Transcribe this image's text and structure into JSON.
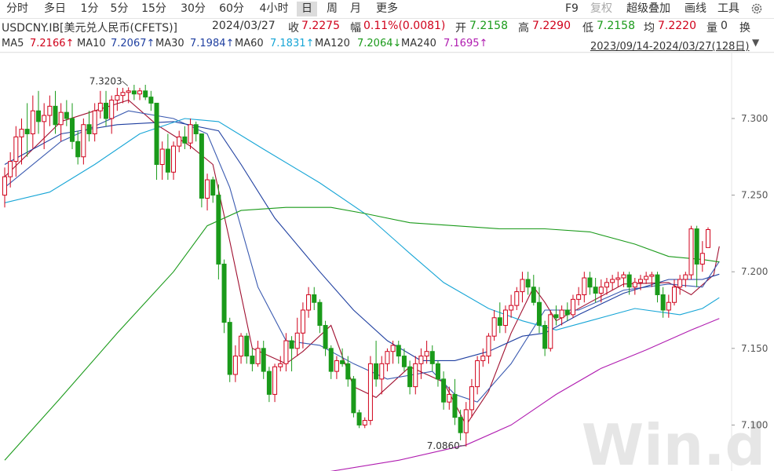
{
  "toolbar": {
    "periods": [
      "分时",
      "多日",
      "1分",
      "5分",
      "15分",
      "30分",
      "60分",
      "4小时",
      "日",
      "周",
      "月",
      "更多"
    ],
    "active_period": "日",
    "right": {
      "f9": "F9",
      "fuquan": "复权",
      "overlay": "超级叠加",
      "draw": "画线",
      "tools": "工具"
    },
    "settings_icon": "gear-icon"
  },
  "info": {
    "symbol": "USDCNY.IB[美元兑人民币(CFETS)]",
    "date": "2024/03/27",
    "close_label": "收",
    "close": "7.2275",
    "change_label": "幅",
    "change": "0.11%(0.0081)",
    "open_label": "开",
    "open": "7.2158",
    "high_label": "高",
    "high": "7.2290",
    "low_label": "低",
    "low": "7.2158",
    "avg_label": "均",
    "avg": "7.2220",
    "vol_label": "量",
    "vol": "0",
    "turnover_label": "换"
  },
  "ma_bar": {
    "items": [
      {
        "label": "MA5",
        "value": "7.2166↑",
        "color": "#333333"
      },
      {
        "label": "MA10",
        "value": "7.2067↑",
        "color": "#1f3fa0"
      },
      {
        "label": "MA30",
        "value": "7.1984↑",
        "color": "#1f3fa0"
      },
      {
        "label": "MA60",
        "value": "7.1831↑",
        "color": "#16a5d6"
      },
      {
        "label": "MA120",
        "value": "7.2064↓",
        "color": "#1a9a1a"
      },
      {
        "label": "MA240",
        "value": "7.1695↑",
        "color": "#b01cb0"
      }
    ],
    "range": "2023/09/14-2024/03/27(128日)"
  },
  "watermark": "Win.d",
  "chart_data": {
    "type": "candlestick",
    "yticks": [
      7.1,
      7.15,
      7.2,
      7.25,
      7.3
    ],
    "ylim": [
      7.07,
      7.343
    ],
    "annotations": [
      {
        "text": "7.3203",
        "index": 22,
        "value": 7.3203
      },
      {
        "text": "7.0860",
        "index": 82,
        "value": 7.086
      }
    ],
    "colors": {
      "up": "#d0021b",
      "down": "#1a9a1a"
    },
    "ohlc": [
      [
        7.25,
        7.268,
        7.242,
        7.262
      ],
      [
        7.262,
        7.278,
        7.255,
        7.272
      ],
      [
        7.272,
        7.295,
        7.262,
        7.288
      ],
      [
        7.288,
        7.3,
        7.27,
        7.293
      ],
      [
        7.293,
        7.31,
        7.275,
        7.29
      ],
      [
        7.29,
        7.315,
        7.28,
        7.305
      ],
      [
        7.305,
        7.318,
        7.29,
        7.298
      ],
      [
        7.298,
        7.31,
        7.28,
        7.302
      ],
      [
        7.302,
        7.315,
        7.295,
        7.308
      ],
      [
        7.308,
        7.318,
        7.29,
        7.296
      ],
      [
        7.296,
        7.31,
        7.285,
        7.304
      ],
      [
        7.304,
        7.312,
        7.295,
        7.3
      ],
      [
        7.3,
        7.31,
        7.28,
        7.285
      ],
      [
        7.285,
        7.292,
        7.27,
        7.275
      ],
      [
        7.275,
        7.3,
        7.27,
        7.296
      ],
      [
        7.296,
        7.305,
        7.285,
        7.29
      ],
      [
        7.29,
        7.31,
        7.285,
        7.305
      ],
      [
        7.305,
        7.318,
        7.3,
        7.31
      ],
      [
        7.31,
        7.318,
        7.295,
        7.3
      ],
      [
        7.3,
        7.315,
        7.29,
        7.312
      ],
      [
        7.312,
        7.32,
        7.305,
        7.315
      ],
      [
        7.315,
        7.32,
        7.31,
        7.317
      ],
      [
        7.317,
        7.3203,
        7.31,
        7.318
      ],
      [
        7.318,
        7.322,
        7.312,
        7.316
      ],
      [
        7.316,
        7.32,
        7.312,
        7.318
      ],
      [
        7.318,
        7.322,
        7.312,
        7.314
      ],
      [
        7.314,
        7.318,
        7.305,
        7.31
      ],
      [
        7.31,
        7.3,
        7.26,
        7.27
      ],
      [
        7.27,
        7.285,
        7.26,
        7.28
      ],
      [
        7.28,
        7.29,
        7.26,
        7.265
      ],
      [
        7.265,
        7.285,
        7.26,
        7.282
      ],
      [
        7.282,
        7.292,
        7.278,
        7.288
      ],
      [
        7.288,
        7.295,
        7.28,
        7.284
      ],
      [
        7.284,
        7.3,
        7.28,
        7.296
      ],
      [
        7.296,
        7.298,
        7.285,
        7.29
      ],
      [
        7.29,
        7.29,
        7.242,
        7.248
      ],
      [
        7.248,
        7.264,
        7.24,
        7.26
      ],
      [
        7.26,
        7.262,
        7.245,
        7.25
      ],
      [
        7.25,
        7.257,
        7.195,
        7.205
      ],
      [
        7.205,
        7.208,
        7.16,
        7.167
      ],
      [
        7.167,
        7.17,
        7.128,
        7.133
      ],
      [
        7.133,
        7.152,
        7.128,
        7.145
      ],
      [
        7.145,
        7.16,
        7.14,
        7.158
      ],
      [
        7.158,
        7.16,
        7.14,
        7.145
      ],
      [
        7.145,
        7.15,
        7.135,
        7.14
      ],
      [
        7.14,
        7.155,
        7.138,
        7.15
      ],
      [
        7.15,
        7.155,
        7.13,
        7.135
      ],
      [
        7.135,
        7.138,
        7.115,
        7.12
      ],
      [
        7.12,
        7.14,
        7.115,
        7.138
      ],
      [
        7.138,
        7.145,
        7.135,
        7.14
      ],
      [
        7.14,
        7.16,
        7.135,
        7.155
      ],
      [
        7.155,
        7.158,
        7.135,
        7.15
      ],
      [
        7.15,
        7.17,
        7.145,
        7.16
      ],
      [
        7.16,
        7.18,
        7.15,
        7.175
      ],
      [
        7.175,
        7.19,
        7.17,
        7.185
      ],
      [
        7.185,
        7.19,
        7.175,
        7.18
      ],
      [
        7.18,
        7.182,
        7.16,
        7.165
      ],
      [
        7.165,
        7.168,
        7.145,
        7.15
      ],
      [
        7.15,
        7.152,
        7.13,
        7.135
      ],
      [
        7.135,
        7.145,
        7.13,
        7.142
      ],
      [
        7.142,
        7.15,
        7.138,
        7.14
      ],
      [
        7.14,
        7.145,
        7.125,
        7.13
      ],
      [
        7.13,
        7.132,
        7.105,
        7.108
      ],
      [
        7.108,
        7.11,
        7.098,
        7.1
      ],
      [
        7.1,
        7.105,
        7.098,
        7.103
      ],
      [
        7.103,
        7.145,
        7.1,
        7.14
      ],
      [
        7.14,
        7.155,
        7.125,
        7.13
      ],
      [
        7.13,
        7.145,
        7.12,
        7.14
      ],
      [
        7.14,
        7.15,
        7.135,
        7.148
      ],
      [
        7.148,
        7.155,
        7.14,
        7.152
      ],
      [
        7.152,
        7.155,
        7.14,
        7.145
      ],
      [
        7.145,
        7.15,
        7.135,
        7.138
      ],
      [
        7.138,
        7.142,
        7.12,
        7.125
      ],
      [
        7.125,
        7.145,
        7.12,
        7.14
      ],
      [
        7.14,
        7.15,
        7.13,
        7.145
      ],
      [
        7.145,
        7.155,
        7.14,
        7.148
      ],
      [
        7.148,
        7.152,
        7.135,
        7.14
      ],
      [
        7.14,
        7.142,
        7.125,
        7.13
      ],
      [
        7.13,
        7.135,
        7.11,
        7.115
      ],
      [
        7.115,
        7.125,
        7.11,
        7.12
      ],
      [
        7.12,
        7.13,
        7.1,
        7.105
      ],
      [
        7.105,
        7.11,
        7.09,
        7.095
      ],
      [
        7.095,
        7.115,
        7.086,
        7.11
      ],
      [
        7.11,
        7.13,
        7.105,
        7.125
      ],
      [
        7.125,
        7.145,
        7.12,
        7.142
      ],
      [
        7.142,
        7.15,
        7.138,
        7.145
      ],
      [
        7.145,
        7.16,
        7.14,
        7.158
      ],
      [
        7.158,
        7.175,
        7.155,
        7.17
      ],
      [
        7.17,
        7.18,
        7.16,
        7.165
      ],
      [
        7.165,
        7.178,
        7.16,
        7.175
      ],
      [
        7.175,
        7.185,
        7.17,
        7.178
      ],
      [
        7.178,
        7.19,
        7.175,
        7.187
      ],
      [
        7.187,
        7.2,
        7.18,
        7.195
      ],
      [
        7.195,
        7.2,
        7.185,
        7.19
      ],
      [
        7.19,
        7.198,
        7.178,
        7.18
      ],
      [
        7.18,
        7.19,
        7.16,
        7.165
      ],
      [
        7.165,
        7.168,
        7.145,
        7.15
      ],
      [
        7.15,
        7.175,
        7.148,
        7.172
      ],
      [
        7.172,
        7.178,
        7.165,
        7.17
      ],
      [
        7.17,
        7.178,
        7.165,
        7.175
      ],
      [
        7.175,
        7.18,
        7.168,
        7.172
      ],
      [
        7.172,
        7.185,
        7.17,
        7.182
      ],
      [
        7.182,
        7.19,
        7.178,
        7.185
      ],
      [
        7.185,
        7.2,
        7.18,
        7.196
      ],
      [
        7.196,
        7.2,
        7.185,
        7.19
      ],
      [
        7.19,
        7.196,
        7.18,
        7.186
      ],
      [
        7.186,
        7.195,
        7.18,
        7.19
      ],
      [
        7.19,
        7.196,
        7.185,
        7.193
      ],
      [
        7.193,
        7.198,
        7.188,
        7.195
      ],
      [
        7.195,
        7.2,
        7.19,
        7.196
      ],
      [
        7.196,
        7.2,
        7.19,
        7.198
      ],
      [
        7.198,
        7.2,
        7.185,
        7.19
      ],
      [
        7.19,
        7.196,
        7.185,
        7.193
      ],
      [
        7.193,
        7.198,
        7.188,
        7.195
      ],
      [
        7.195,
        7.2,
        7.192,
        7.197
      ],
      [
        7.197,
        7.2,
        7.19,
        7.198
      ],
      [
        7.198,
        7.2,
        7.18,
        7.185
      ],
      [
        7.185,
        7.19,
        7.17,
        7.175
      ],
      [
        7.175,
        7.185,
        7.17,
        7.18
      ],
      [
        7.18,
        7.195,
        7.178,
        7.19
      ],
      [
        7.19,
        7.198,
        7.185,
        7.195
      ],
      [
        7.195,
        7.2,
        7.19,
        7.198
      ],
      [
        7.198,
        7.23,
        7.195,
        7.228
      ],
      [
        7.228,
        7.23,
        7.19,
        7.205
      ],
      [
        7.205,
        7.22,
        7.2,
        7.212
      ],
      [
        7.2158,
        7.229,
        7.2158,
        7.2275
      ]
    ],
    "ma_lines": [
      {
        "name": "MA5",
        "color": "#a01030",
        "points": [
          [
            0,
            7.262
          ],
          [
            10,
            7.298
          ],
          [
            22,
            7.312
          ],
          [
            27,
            7.296
          ],
          [
            33,
            7.282
          ],
          [
            37,
            7.27
          ],
          [
            40,
            7.22
          ],
          [
            44,
            7.15
          ],
          [
            50,
            7.14
          ],
          [
            53,
            7.148
          ],
          [
            58,
            7.165
          ],
          [
            62,
            7.125
          ],
          [
            66,
            7.118
          ],
          [
            72,
            7.138
          ],
          [
            78,
            7.128
          ],
          [
            82,
            7.1
          ],
          [
            86,
            7.122
          ],
          [
            90,
            7.16
          ],
          [
            94,
            7.19
          ],
          [
            96,
            7.18
          ],
          [
            98,
            7.168
          ],
          [
            104,
            7.18
          ],
          [
            110,
            7.192
          ],
          [
            118,
            7.193
          ],
          [
            122,
            7.185
          ],
          [
            126,
            7.198
          ],
          [
            127,
            7.2166
          ]
        ]
      },
      {
        "name": "MA10",
        "color": "#3a5ab0",
        "points": [
          [
            0,
            7.255
          ],
          [
            10,
            7.285
          ],
          [
            22,
            7.305
          ],
          [
            30,
            7.3
          ],
          [
            36,
            7.29
          ],
          [
            40,
            7.255
          ],
          [
            45,
            7.19
          ],
          [
            50,
            7.155
          ],
          [
            56,
            7.152
          ],
          [
            62,
            7.14
          ],
          [
            68,
            7.13
          ],
          [
            76,
            7.135
          ],
          [
            80,
            7.12
          ],
          [
            84,
            7.115
          ],
          [
            90,
            7.14
          ],
          [
            96,
            7.175
          ],
          [
            102,
            7.175
          ],
          [
            110,
            7.188
          ],
          [
            118,
            7.192
          ],
          [
            124,
            7.19
          ],
          [
            127,
            7.2067
          ]
        ]
      },
      {
        "name": "MA30",
        "color": "#1f3fa0",
        "points": [
          [
            0,
            7.27
          ],
          [
            10,
            7.29
          ],
          [
            20,
            7.296
          ],
          [
            30,
            7.298
          ],
          [
            38,
            7.292
          ],
          [
            42,
            7.27
          ],
          [
            48,
            7.235
          ],
          [
            56,
            7.2
          ],
          [
            62,
            7.175
          ],
          [
            68,
            7.155
          ],
          [
            74,
            7.142
          ],
          [
            80,
            7.142
          ],
          [
            86,
            7.148
          ],
          [
            92,
            7.158
          ],
          [
            96,
            7.16
          ],
          [
            102,
            7.172
          ],
          [
            110,
            7.186
          ],
          [
            118,
            7.195
          ],
          [
            124,
            7.195
          ],
          [
            127,
            7.1984
          ]
        ]
      },
      {
        "name": "MA60",
        "color": "#16a5d6",
        "points": [
          [
            0,
            7.245
          ],
          [
            8,
            7.252
          ],
          [
            16,
            7.27
          ],
          [
            24,
            7.29
          ],
          [
            32,
            7.3
          ],
          [
            38,
            7.298
          ],
          [
            46,
            7.28
          ],
          [
            56,
            7.258
          ],
          [
            64,
            7.238
          ],
          [
            72,
            7.212
          ],
          [
            78,
            7.193
          ],
          [
            86,
            7.176
          ],
          [
            92,
            7.168
          ],
          [
            98,
            7.162
          ],
          [
            104,
            7.168
          ],
          [
            112,
            7.176
          ],
          [
            120,
            7.172
          ],
          [
            124,
            7.176
          ],
          [
            127,
            7.1831
          ]
        ]
      },
      {
        "name": "MA120",
        "color": "#1a9a1a",
        "points": [
          [
            0,
            7.077
          ],
          [
            10,
            7.118
          ],
          [
            20,
            7.16
          ],
          [
            30,
            7.2
          ],
          [
            36,
            7.23
          ],
          [
            42,
            7.24
          ],
          [
            50,
            7.242
          ],
          [
            58,
            7.242
          ],
          [
            64,
            7.238
          ],
          [
            72,
            7.232
          ],
          [
            80,
            7.23
          ],
          [
            88,
            7.228
          ],
          [
            96,
            7.228
          ],
          [
            104,
            7.226
          ],
          [
            112,
            7.218
          ],
          [
            118,
            7.21
          ],
          [
            124,
            7.208
          ],
          [
            127,
            7.2064
          ]
        ]
      },
      {
        "name": "MA240",
        "color": "#b01cb0",
        "points": [
          [
            35,
            7.063
          ],
          [
            55,
            7.068
          ],
          [
            70,
            7.077
          ],
          [
            82,
            7.087
          ],
          [
            90,
            7.1
          ],
          [
            98,
            7.12
          ],
          [
            106,
            7.137
          ],
          [
            114,
            7.149
          ],
          [
            122,
            7.162
          ],
          [
            127,
            7.1695
          ]
        ]
      }
    ]
  }
}
